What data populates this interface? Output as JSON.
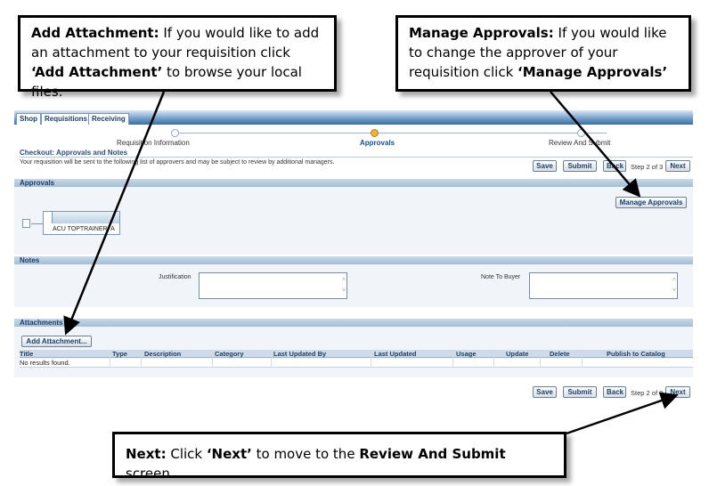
{
  "callouts": {
    "attachment": {
      "title": "Add Attachment:",
      "text1": " If you would like to add an attachment to your requisition click ",
      "emph": "‘Add Attachment’",
      "text2": " to browse your local files."
    },
    "approvals": {
      "title": "Manage Approvals:",
      "text1": " If you would like to change the approver of your requisition click ",
      "emph": "‘Manage Approvals’"
    },
    "next": {
      "title": "Next:",
      "text1": " Click ",
      "emph": "‘Next’",
      "text2": " to move to the ",
      "emph2": "Review And Submit",
      "text3": " screen."
    }
  },
  "tabs": [
    "Shop",
    "Requisitions",
    "Receiving"
  ],
  "train": {
    "steps": [
      "Requisition Information",
      "Approvals",
      "Review And Submit"
    ]
  },
  "page": {
    "title": "Checkout: Approvals and Notes",
    "instructions": "Your requisition will be sent to the following list of approvers and may be subject to review by additional managers."
  },
  "buttons": {
    "save": "Save",
    "submit": "Submit",
    "back": "Back",
    "next": "Next",
    "step": "Step 2 of 3",
    "manage_approvals": "Manage Approvals",
    "add_attachment": "Add Attachment..."
  },
  "sections": {
    "approvals": "Approvals",
    "notes": "Notes",
    "attachments": "Attachments"
  },
  "approver": {
    "name": "ACU TOPTRAINER, A"
  },
  "notes": {
    "justification_label": "Justification",
    "note_to_buyer_label": "Note To Buyer"
  },
  "attachments_table": {
    "columns": [
      "Title",
      "Type",
      "Description",
      "Category",
      "Last Updated By",
      "Last Updated",
      "Usage",
      "Update",
      "Delete",
      "Publish to Catalog"
    ],
    "empty_text": "No results found."
  },
  "colors": {
    "header_blue": "#3c6ea3",
    "section_blue": "#a4bdd7",
    "link_blue": "#1e3f66",
    "active_step": "#f3b23f"
  }
}
